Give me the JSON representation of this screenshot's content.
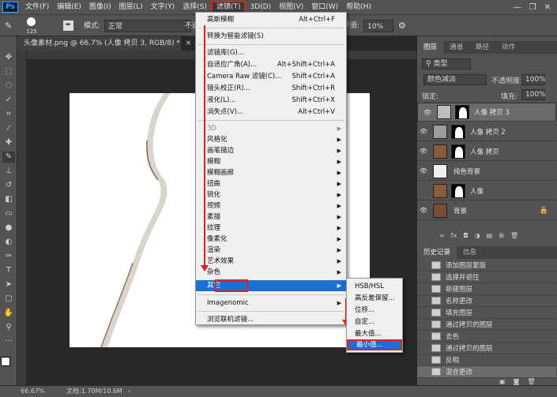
{
  "menubar": {
    "logo": "Ps",
    "items": [
      "文件(F)",
      "编辑(E)",
      "图像(I)",
      "图层(L)",
      "文字(Y)",
      "选择(S)",
      "滤镜(T)",
      "3D(D)",
      "视图(V)",
      "窗口(W)",
      "帮助(H)"
    ],
    "window_controls": [
      "—",
      "❐",
      "✕"
    ]
  },
  "options": {
    "brush_size": "125",
    "mode_label": "模式:",
    "mode_value": "正常",
    "opacity_prefix": "不透",
    "smooth_label": "平滑:",
    "smooth_value": "10%"
  },
  "document": {
    "tab_title": "头像素材.png @ 66.7% (人像 拷贝 3, RGB/8) *",
    "tab_close": "×"
  },
  "filter_menu": {
    "items": [
      {
        "label": "高斯模糊",
        "shortcut": "Alt+Ctrl+F"
      },
      {
        "label": "转换为智能滤镜(S)",
        "shortcut": ""
      },
      {
        "label": "滤镜库(G)...",
        "shortcut": ""
      },
      {
        "label": "自适应广角(A)...",
        "shortcut": "Alt+Shift+Ctrl+A"
      },
      {
        "label": "Camera Raw 滤镜(C)...",
        "shortcut": "Shift+Ctrl+A"
      },
      {
        "label": "镜头校正(R)...",
        "shortcut": "Shift+Ctrl+R"
      },
      {
        "label": "液化(L)...",
        "shortcut": "Shift+Ctrl+X"
      },
      {
        "label": "消失点(V)...",
        "shortcut": "Alt+Ctrl+V"
      },
      {
        "label": "3D",
        "shortcut": ""
      },
      {
        "label": "风格化",
        "shortcut": ""
      },
      {
        "label": "画笔描边",
        "shortcut": ""
      },
      {
        "label": "模糊",
        "shortcut": ""
      },
      {
        "label": "模糊画廊",
        "shortcut": ""
      },
      {
        "label": "扭曲",
        "shortcut": ""
      },
      {
        "label": "锐化",
        "shortcut": ""
      },
      {
        "label": "视频",
        "shortcut": ""
      },
      {
        "label": "素描",
        "shortcut": ""
      },
      {
        "label": "纹理",
        "shortcut": ""
      },
      {
        "label": "像素化",
        "shortcut": ""
      },
      {
        "label": "渲染",
        "shortcut": ""
      },
      {
        "label": "艺术效果",
        "shortcut": ""
      },
      {
        "label": "杂色",
        "shortcut": ""
      },
      {
        "label": "其它",
        "shortcut": ""
      },
      {
        "label": "Imagenomic",
        "shortcut": ""
      },
      {
        "label": "浏览联机滤镜...",
        "shortcut": ""
      }
    ]
  },
  "other_submenu": {
    "items": [
      "HSB/HSL",
      "高反差保留...",
      "位移...",
      "自定...",
      "最大值...",
      "最小值..."
    ]
  },
  "panels": {
    "layers_tabs": [
      "图层",
      "通道",
      "路径",
      "动作"
    ],
    "kind_label": "类型",
    "blend_mode": "颜色减淡",
    "opacity_label": "不透明度:",
    "opacity_value": "100%",
    "lock_label": "锁定:",
    "fill_label": "填充:",
    "fill_value": "100%",
    "layers": [
      {
        "name": "人像 拷贝 3",
        "visible": true
      },
      {
        "name": "人像 拷贝 2",
        "visible": true
      },
      {
        "name": "人像 拷贝",
        "visible": true
      },
      {
        "name": "纯色背景",
        "visible": true
      },
      {
        "name": "人像",
        "visible": false
      },
      {
        "name": "背景",
        "visible": true
      }
    ],
    "history_tabs": [
      "历史记录",
      "信息"
    ],
    "history": [
      "添加图层蒙版",
      "选择并遮住",
      "新建图层",
      "名称更改",
      "填充图层",
      "通过拷贝的图层",
      "去色",
      "通过拷贝的图层",
      "反相",
      "混合更改"
    ]
  },
  "status": {
    "zoom": "66.67%",
    "doc_info": "文档:1.70M/10.6M"
  },
  "colors": {
    "highlight": "#1a6fd6",
    "annotation_red": "#e0221a"
  }
}
